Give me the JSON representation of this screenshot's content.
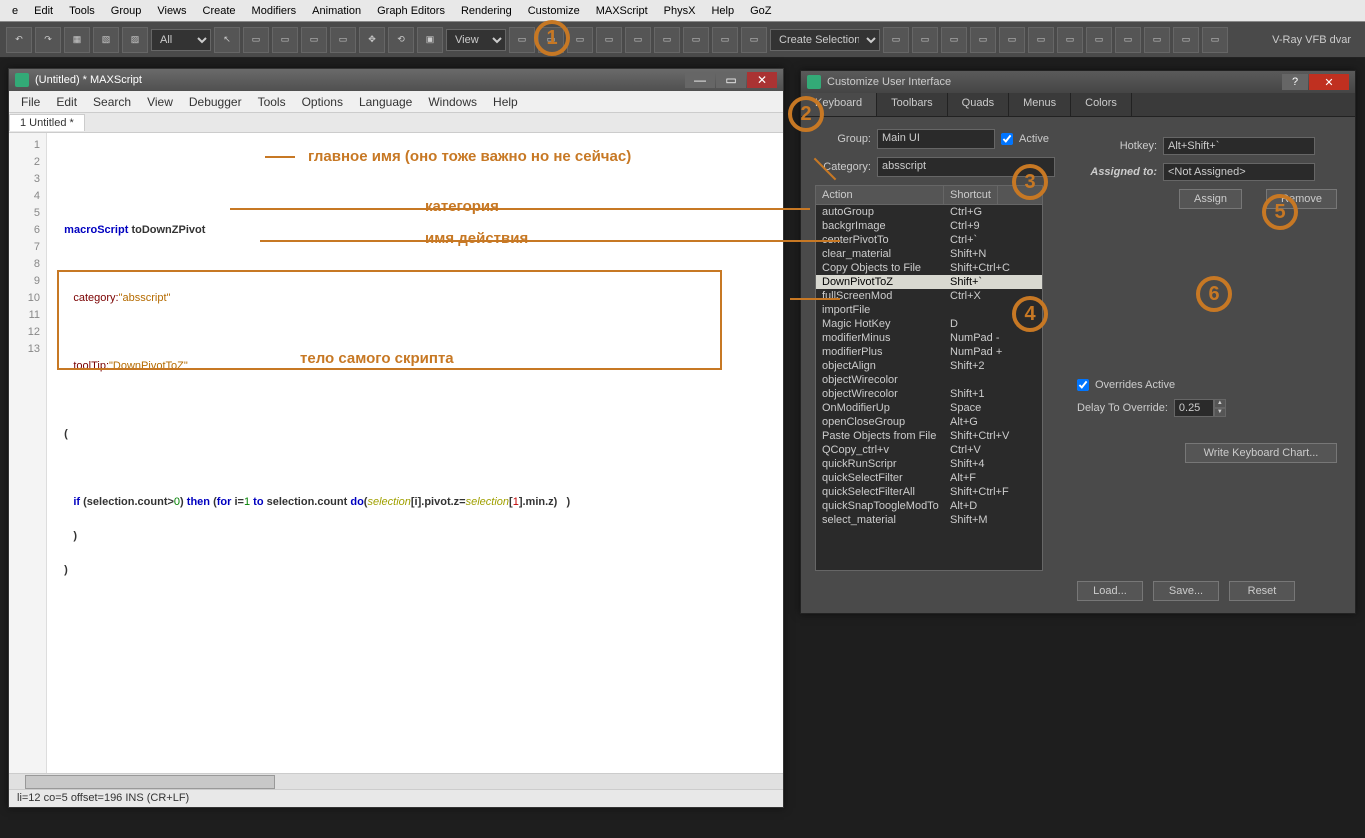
{
  "mainMenu": [
    "e",
    "Edit",
    "Tools",
    "Group",
    "Views",
    "Create",
    "Modifiers",
    "Animation",
    "Graph Editors",
    "Rendering",
    "Customize",
    "MAXScript",
    "PhysX",
    "Help",
    "GoZ"
  ],
  "toolbarSelects": {
    "all": "All",
    "view": "View",
    "createSel": "Create Selection Set"
  },
  "vray": "V-Ray VFB   dvar",
  "scriptWin": {
    "title": "(Untitled) * MAXScript",
    "menu": [
      "File",
      "Edit",
      "Search",
      "View",
      "Debugger",
      "Tools",
      "Options",
      "Language",
      "Windows",
      "Help"
    ],
    "tab": "1 Untitled *",
    "lines": [
      "1",
      "2",
      "3",
      "4",
      "5",
      "6",
      "7",
      "8",
      "9",
      "10",
      "11",
      "12",
      "13"
    ],
    "code": {
      "l3a": "macroScript",
      "l3b": "toDownZPivot",
      "l5a": "category:",
      "l5b": "\"absscript\"",
      "l7a": "toolTip:",
      "l7b": "\"DownPivotToZ\"",
      "l9": "(",
      "l11a": "if",
      "l11b": "(selection.count>",
      "l11c": "0",
      "l11d": ") ",
      "l11e": "then",
      "l11f": " (",
      "l11g": "for",
      "l11h": " i=",
      "l11i": "1",
      "l11j": " to",
      "l11k": " selection.count ",
      "l11l": "do",
      "l11m": "(",
      "l11n": "selection",
      "l11o": "[i].pivot.z=",
      "l11p": "selection",
      "l11q": "[",
      "l11r": "1",
      "l11s": "].min.z)   )",
      "l12": " )",
      "l13": ")"
    },
    "status": "li=12 co=5 offset=196 INS (CR+LF)"
  },
  "annotations": {
    "a1": "главное имя (оно тоже важно но не сейчас)",
    "a2": "категория",
    "a3": "имя действия",
    "a4": "тело самого скрипта"
  },
  "custWin": {
    "title": "Customize User Interface",
    "tabs": [
      "Keyboard",
      "Toolbars",
      "Quads",
      "Menus",
      "Colors"
    ],
    "groupLabel": "Group:",
    "group": "Main UI",
    "activeLabel": "Active",
    "categoryLabel": "Category:",
    "category": "absscript",
    "listHeader": {
      "action": "Action",
      "shortcut": "Shortcut"
    },
    "actions": [
      {
        "a": "autoGroup",
        "s": "Ctrl+G"
      },
      {
        "a": "backgrImage",
        "s": "Ctrl+9"
      },
      {
        "a": "centerPivotTo",
        "s": "Ctrl+`"
      },
      {
        "a": "clear_material",
        "s": "Shift+N"
      },
      {
        "a": "Copy Objects to File",
        "s": "Shift+Ctrl+C"
      },
      {
        "a": "DownPivotToZ",
        "s": "Shift+`"
      },
      {
        "a": "fullScreenMod",
        "s": "Ctrl+X"
      },
      {
        "a": "importFile",
        "s": ""
      },
      {
        "a": "Magic HotKey",
        "s": "D"
      },
      {
        "a": "modifierMinus",
        "s": "NumPad -"
      },
      {
        "a": "modifierPlus",
        "s": "NumPad +"
      },
      {
        "a": "objectAlign",
        "s": "Shift+2"
      },
      {
        "a": "objectWirecolor",
        "s": ""
      },
      {
        "a": "objectWirecolor",
        "s": "Shift+1"
      },
      {
        "a": "OnModifierUp",
        "s": "Space"
      },
      {
        "a": "openCloseGroup",
        "s": "Alt+G"
      },
      {
        "a": "Paste Objects from File",
        "s": "Shift+Ctrl+V"
      },
      {
        "a": "QCopy_ctrl+v",
        "s": "Ctrl+V"
      },
      {
        "a": "quickRunScripr",
        "s": "Shift+4"
      },
      {
        "a": "quickSelectFilter",
        "s": "Alt+F"
      },
      {
        "a": "quickSelectFilterAll",
        "s": "Shift+Ctrl+F"
      },
      {
        "a": "quickSnapToogleModTo",
        "s": "Alt+D"
      },
      {
        "a": "select_material",
        "s": "Shift+M"
      }
    ],
    "hotkeyLabel": "Hotkey:",
    "hotkey": "Alt+Shift+`",
    "assignedLabel": "Assigned to:",
    "assigned": "<Not Assigned>",
    "assignBtn": "Assign",
    "removeBtn": "Remove",
    "overridesLabel": "Overrides Active",
    "delayLabel": "Delay To Override:",
    "delay": "0.25",
    "writeBtn": "Write Keyboard Chart...",
    "loadBtn": "Load...",
    "saveBtn": "Save...",
    "resetBtn": "Reset"
  },
  "circles": [
    "1",
    "2",
    "3",
    "4",
    "5",
    "6"
  ]
}
